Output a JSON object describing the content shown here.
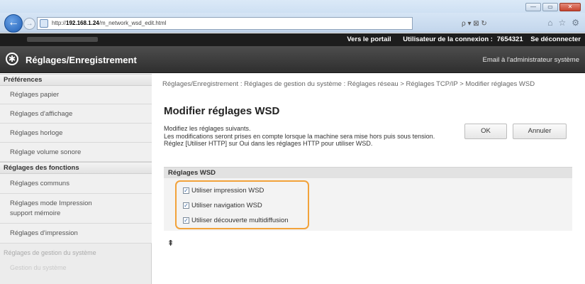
{
  "browser": {
    "url_prefix": "http://",
    "url_host": "192.168.1.24",
    "url_path": "/m_network_wsd_edit.html",
    "search_label": "ρ ▾ ⊠ ↻",
    "window_buttons": [
      "—",
      "▭",
      "✕"
    ]
  },
  "topbar": {
    "portal_link": "Vers le portail",
    "login_user_label": "Utilisateur de la connexion :",
    "login_user_value": "7654321",
    "logout_link": "Se déconnecter"
  },
  "header": {
    "title": "Réglages/Enregistrement",
    "admin_mail": "Email à l'administrateur système"
  },
  "sidebar": {
    "section_preferences": "Préférences",
    "preferences_items": [
      "Réglages papier",
      "Réglages d'affichage",
      "Réglages horloge",
      "Réglage volume sonore"
    ],
    "section_functions": "Réglages des fonctions",
    "functions_items": [
      "Réglages communs",
      "Réglages mode Impression support mémoire",
      "Réglages d'impression"
    ],
    "section_system": "Réglages de gestion du système",
    "system_items": [
      "Gestion du système"
    ]
  },
  "main": {
    "breadcrumb": "Réglages/Enregistrement : Réglages de gestion du système : Réglages réseau > Réglages TCP/IP > Modifier réglages WSD",
    "title": "Modifier réglages WSD",
    "desc_line1": "Modifiez les réglages suivants.",
    "desc_line2": "Les modifications seront prises en compte lorsque la machine sera mise hors puis sous tension.",
    "desc_line3": "Réglez [Utiliser HTTP] sur Oui dans les réglages HTTP pour utiliser WSD.",
    "ok_label": "OK",
    "cancel_label": "Annuler",
    "panel_title": "Réglages WSD",
    "checkboxes": [
      {
        "label": "Utiliser impression WSD",
        "checked": true
      },
      {
        "label": "Utiliser navigation WSD",
        "checked": true
      },
      {
        "label": "Utiliser découverte multidiffusion",
        "checked": true
      }
    ],
    "to_top_icon": "⇞"
  },
  "colors": {
    "highlight": "#f2a23a",
    "header_bg": "#1d1d1d"
  }
}
